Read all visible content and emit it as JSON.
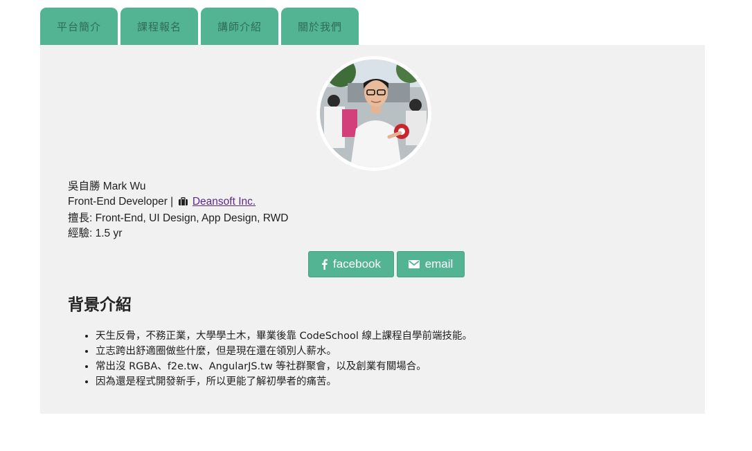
{
  "tabs": [
    {
      "label": "平台簡介"
    },
    {
      "label": "課程報名"
    },
    {
      "label": "講師介紹"
    },
    {
      "label": "關於我們"
    }
  ],
  "profile": {
    "name": "吳自勝 Mark Wu",
    "role_prefix": "Front-End Developer |",
    "company_icon": "briefcase-icon",
    "company": "Deansoft Inc.",
    "skills": "擅長: Front-End, UI Design, App Design, RWD",
    "experience": "經驗: 1.5 yr"
  },
  "social": {
    "facebook_label": "facebook",
    "facebook_icon": "facebook-icon",
    "email_label": "email",
    "email_icon": "envelope-icon"
  },
  "background": {
    "title": "背景介紹",
    "items": [
      "天生反骨，不務正業，大學學土木，畢業後靠 CodeSchool 線上課程自學前端技能。",
      "立志跨出舒適圈做些什麼，但是現在還在領別人薪水。",
      "常出沒 RGBA、f2e.tw、AngularJS.tw 等社群聚會，以及創業有關場合。",
      "因為還是程式開發新手，所以更能了解初學者的痛苦。"
    ]
  },
  "colors": {
    "accent": "#52b493",
    "panel_bg": "#f1f1f1",
    "link": "#5a2a86"
  }
}
